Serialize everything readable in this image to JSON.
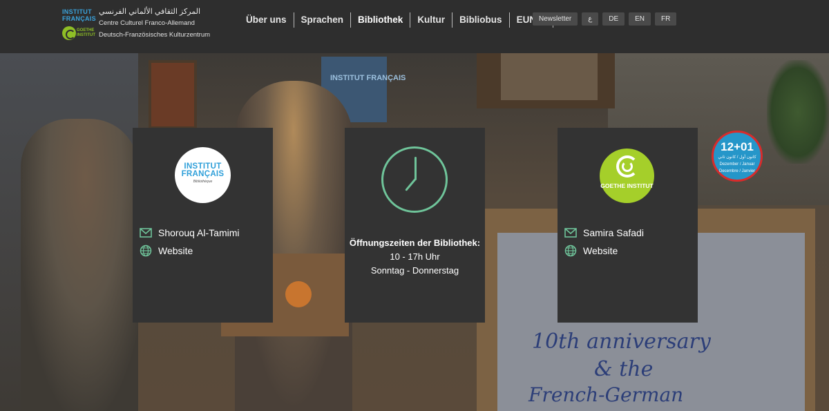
{
  "header": {
    "logo": {
      "institut_francais": "INSTITUT FRANÇAIS",
      "goethe": "GOETHE INSTITUT",
      "arabic": "المركز الثقافي الألماني الفرنسي",
      "french": "Centre Culturel Franco-Allemand",
      "german": "Deutsch-Französisches Kulturzentrum"
    },
    "nav": [
      {
        "label": "Über uns"
      },
      {
        "label": "Sprachen"
      },
      {
        "label": "Bibliothek"
      },
      {
        "label": "Kultur"
      },
      {
        "label": "Bibliobus"
      },
      {
        "label": "EUNIC"
      }
    ],
    "active_nav": "Bibliothek",
    "newsletter": "Newsletter",
    "languages": [
      "ع",
      "DE",
      "EN",
      "FR"
    ]
  },
  "hero": {
    "banner_text": "INSTITUT FRANÇAIS",
    "board_lines": [
      "10th anniversary",
      "& the",
      "French-German"
    ],
    "sticker": {
      "number": "12+01",
      "line1": "كانون أول / كانون ثاني",
      "line2": "Dezember / Januar",
      "line3": "Decembre / Janvier"
    }
  },
  "cards": {
    "left": {
      "logo_text": "INSTITUT FRANÇAIS",
      "logo_sub": "Bibliothèque",
      "email_name": "Shorouq Al-Tamimi",
      "website": "Website"
    },
    "middle": {
      "title": "Öffnungszeiten der Bibliothek:",
      "hours": "10 - 17h Uhr",
      "days": "Sonntag - Donnerstag"
    },
    "right": {
      "logo_text": "GOETHE INSTITUT",
      "email_name": "Samira Safadi",
      "website": "Website"
    }
  },
  "colors": {
    "header_bg": "#2e2e2e",
    "card_bg": "#333333",
    "clock_green": "#6fc49a",
    "goethe_green": "#a5cf2a",
    "if_blue": "#2e9fd9"
  },
  "icons": [
    "mail-icon",
    "globe-icon",
    "clock-icon"
  ]
}
